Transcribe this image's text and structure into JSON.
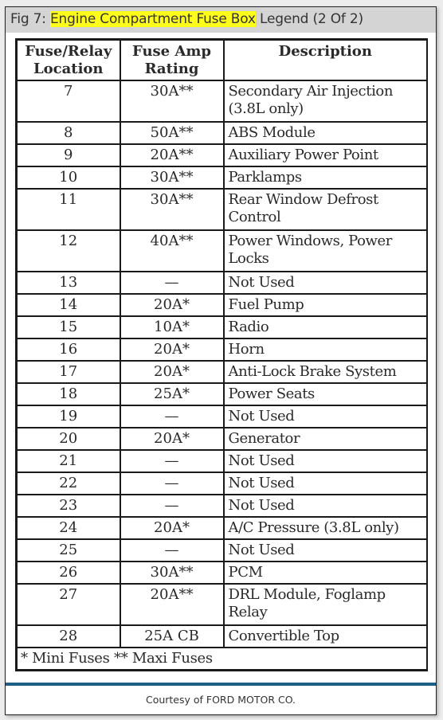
{
  "figure": {
    "label": "Fig 7: ",
    "highlighted_title": "Engine Compartment Fuse Box",
    "title_suffix": " Legend (2 Of 2)",
    "highlight_color": "#ffff1a",
    "caption": "Courtesy of FORD MOTOR CO.",
    "divider_color": "#1e5f86"
  },
  "table": {
    "headers": [
      "Fuse/Relay Location",
      "Fuse Amp Rating",
      "Description"
    ],
    "rows": [
      {
        "location": "7",
        "rating": "30A**",
        "description": "Secondary Air Injection (3.8L only)"
      },
      {
        "location": "8",
        "rating": "50A**",
        "description": "ABS Module"
      },
      {
        "location": "9",
        "rating": "20A**",
        "description": "Auxiliary Power Point"
      },
      {
        "location": "10",
        "rating": "30A**",
        "description": "Parklamps"
      },
      {
        "location": "11",
        "rating": "30A**",
        "description": "Rear Window Defrost Control"
      },
      {
        "location": "12",
        "rating": "40A**",
        "description": "Power Windows, Power Locks"
      },
      {
        "location": "13",
        "rating": "—",
        "description": "Not Used"
      },
      {
        "location": "14",
        "rating": "20A*",
        "description": "Fuel Pump"
      },
      {
        "location": "15",
        "rating": "10A*",
        "description": "Radio"
      },
      {
        "location": "16",
        "rating": "20A*",
        "description": "Horn"
      },
      {
        "location": "17",
        "rating": "20A*",
        "description": "Anti-Lock Brake System"
      },
      {
        "location": "18",
        "rating": "25A*",
        "description": "Power Seats"
      },
      {
        "location": "19",
        "rating": "—",
        "description": "Not Used"
      },
      {
        "location": "20",
        "rating": "20A*",
        "description": "Generator"
      },
      {
        "location": "21",
        "rating": "—",
        "description": "Not Used"
      },
      {
        "location": "22",
        "rating": "—",
        "description": "Not Used"
      },
      {
        "location": "23",
        "rating": "—",
        "description": "Not Used"
      },
      {
        "location": "24",
        "rating": "20A*",
        "description": "A/C Pressure (3.8L only)"
      },
      {
        "location": "25",
        "rating": "—",
        "description": "Not Used"
      },
      {
        "location": "26",
        "rating": "30A**",
        "description": "PCM"
      },
      {
        "location": "27",
        "rating": "20A**",
        "description": "DRL Module, Foglamp Relay"
      },
      {
        "location": "28",
        "rating": "25A CB",
        "description": "Convertible Top"
      }
    ],
    "footnote": "* Mini Fuses ** Maxi Fuses"
  }
}
